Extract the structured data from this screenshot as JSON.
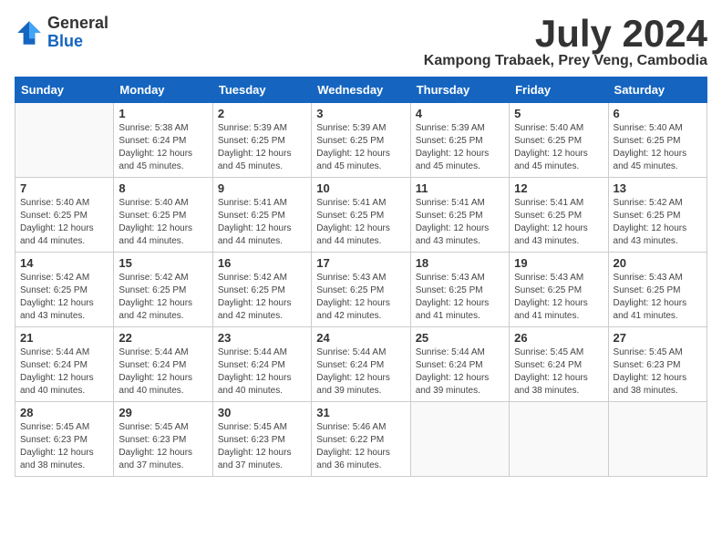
{
  "logo": {
    "general": "General",
    "blue": "Blue"
  },
  "title": "July 2024",
  "location": "Kampong Trabaek, Prey Veng, Cambodia",
  "days_of_week": [
    "Sunday",
    "Monday",
    "Tuesday",
    "Wednesday",
    "Thursday",
    "Friday",
    "Saturday"
  ],
  "weeks": [
    [
      {
        "day": "",
        "info": ""
      },
      {
        "day": "1",
        "info": "Sunrise: 5:38 AM\nSunset: 6:24 PM\nDaylight: 12 hours\nand 45 minutes."
      },
      {
        "day": "2",
        "info": "Sunrise: 5:39 AM\nSunset: 6:25 PM\nDaylight: 12 hours\nand 45 minutes."
      },
      {
        "day": "3",
        "info": "Sunrise: 5:39 AM\nSunset: 6:25 PM\nDaylight: 12 hours\nand 45 minutes."
      },
      {
        "day": "4",
        "info": "Sunrise: 5:39 AM\nSunset: 6:25 PM\nDaylight: 12 hours\nand 45 minutes."
      },
      {
        "day": "5",
        "info": "Sunrise: 5:40 AM\nSunset: 6:25 PM\nDaylight: 12 hours\nand 45 minutes."
      },
      {
        "day": "6",
        "info": "Sunrise: 5:40 AM\nSunset: 6:25 PM\nDaylight: 12 hours\nand 45 minutes."
      }
    ],
    [
      {
        "day": "7",
        "info": "Sunrise: 5:40 AM\nSunset: 6:25 PM\nDaylight: 12 hours\nand 44 minutes."
      },
      {
        "day": "8",
        "info": "Sunrise: 5:40 AM\nSunset: 6:25 PM\nDaylight: 12 hours\nand 44 minutes."
      },
      {
        "day": "9",
        "info": "Sunrise: 5:41 AM\nSunset: 6:25 PM\nDaylight: 12 hours\nand 44 minutes."
      },
      {
        "day": "10",
        "info": "Sunrise: 5:41 AM\nSunset: 6:25 PM\nDaylight: 12 hours\nand 44 minutes."
      },
      {
        "day": "11",
        "info": "Sunrise: 5:41 AM\nSunset: 6:25 PM\nDaylight: 12 hours\nand 43 minutes."
      },
      {
        "day": "12",
        "info": "Sunrise: 5:41 AM\nSunset: 6:25 PM\nDaylight: 12 hours\nand 43 minutes."
      },
      {
        "day": "13",
        "info": "Sunrise: 5:42 AM\nSunset: 6:25 PM\nDaylight: 12 hours\nand 43 minutes."
      }
    ],
    [
      {
        "day": "14",
        "info": "Sunrise: 5:42 AM\nSunset: 6:25 PM\nDaylight: 12 hours\nand 43 minutes."
      },
      {
        "day": "15",
        "info": "Sunrise: 5:42 AM\nSunset: 6:25 PM\nDaylight: 12 hours\nand 42 minutes."
      },
      {
        "day": "16",
        "info": "Sunrise: 5:42 AM\nSunset: 6:25 PM\nDaylight: 12 hours\nand 42 minutes."
      },
      {
        "day": "17",
        "info": "Sunrise: 5:43 AM\nSunset: 6:25 PM\nDaylight: 12 hours\nand 42 minutes."
      },
      {
        "day": "18",
        "info": "Sunrise: 5:43 AM\nSunset: 6:25 PM\nDaylight: 12 hours\nand 41 minutes."
      },
      {
        "day": "19",
        "info": "Sunrise: 5:43 AM\nSunset: 6:25 PM\nDaylight: 12 hours\nand 41 minutes."
      },
      {
        "day": "20",
        "info": "Sunrise: 5:43 AM\nSunset: 6:25 PM\nDaylight: 12 hours\nand 41 minutes."
      }
    ],
    [
      {
        "day": "21",
        "info": "Sunrise: 5:44 AM\nSunset: 6:24 PM\nDaylight: 12 hours\nand 40 minutes."
      },
      {
        "day": "22",
        "info": "Sunrise: 5:44 AM\nSunset: 6:24 PM\nDaylight: 12 hours\nand 40 minutes."
      },
      {
        "day": "23",
        "info": "Sunrise: 5:44 AM\nSunset: 6:24 PM\nDaylight: 12 hours\nand 40 minutes."
      },
      {
        "day": "24",
        "info": "Sunrise: 5:44 AM\nSunset: 6:24 PM\nDaylight: 12 hours\nand 39 minutes."
      },
      {
        "day": "25",
        "info": "Sunrise: 5:44 AM\nSunset: 6:24 PM\nDaylight: 12 hours\nand 39 minutes."
      },
      {
        "day": "26",
        "info": "Sunrise: 5:45 AM\nSunset: 6:24 PM\nDaylight: 12 hours\nand 38 minutes."
      },
      {
        "day": "27",
        "info": "Sunrise: 5:45 AM\nSunset: 6:23 PM\nDaylight: 12 hours\nand 38 minutes."
      }
    ],
    [
      {
        "day": "28",
        "info": "Sunrise: 5:45 AM\nSunset: 6:23 PM\nDaylight: 12 hours\nand 38 minutes."
      },
      {
        "day": "29",
        "info": "Sunrise: 5:45 AM\nSunset: 6:23 PM\nDaylight: 12 hours\nand 37 minutes."
      },
      {
        "day": "30",
        "info": "Sunrise: 5:45 AM\nSunset: 6:23 PM\nDaylight: 12 hours\nand 37 minutes."
      },
      {
        "day": "31",
        "info": "Sunrise: 5:46 AM\nSunset: 6:22 PM\nDaylight: 12 hours\nand 36 minutes."
      },
      {
        "day": "",
        "info": ""
      },
      {
        "day": "",
        "info": ""
      },
      {
        "day": "",
        "info": ""
      }
    ]
  ]
}
